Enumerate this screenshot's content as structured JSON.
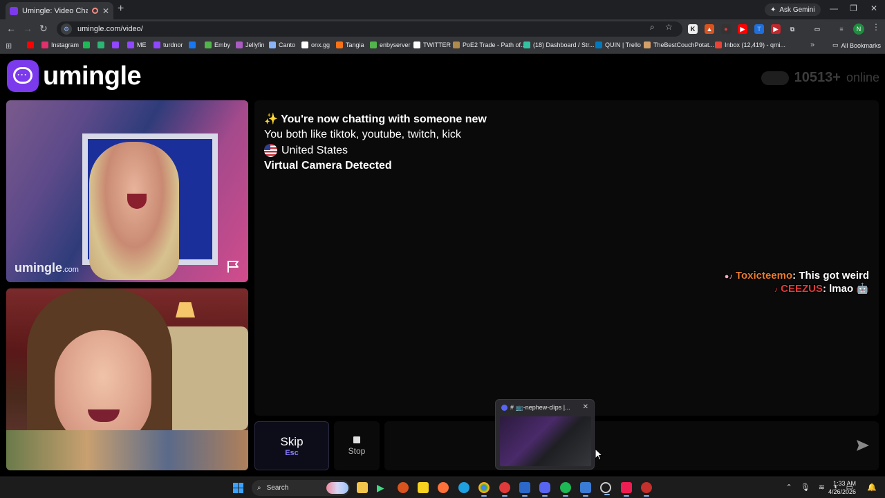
{
  "browser": {
    "tab_title": "Umingle: Video Chat with S",
    "new_tab_symbol": "+",
    "ask_gemini": "Ask Gemini",
    "url": "umingle.com/video/",
    "profile_initial": "N",
    "all_bookmarks": "All Bookmarks",
    "bookmarks": [
      {
        "label": "",
        "icon": "youtube-icon",
        "color": "#ff0000"
      },
      {
        "label": "Instagram",
        "icon": "instagram-icon",
        "color": "#e1306c"
      },
      {
        "label": "",
        "icon": "spotify-icon",
        "color": "#1db954"
      },
      {
        "label": "",
        "icon": "app-icon",
        "color": "#2bb673"
      },
      {
        "label": "",
        "icon": "twitch-icon",
        "color": "#9146ff"
      },
      {
        "label": "ME",
        "icon": "twitch-icon",
        "color": "#9146ff"
      },
      {
        "label": "turdnor",
        "icon": "twitch-icon",
        "color": "#9146ff"
      },
      {
        "label": "",
        "icon": "facebook-icon",
        "color": "#1877f2"
      },
      {
        "label": "Emby",
        "icon": "emby-icon",
        "color": "#52b54b"
      },
      {
        "label": "Jellyfin",
        "icon": "jellyfin-icon",
        "color": "#aa5cc3"
      },
      {
        "label": "Canto",
        "icon": "canto-icon",
        "color": "#8ab4f8"
      },
      {
        "label": "onx.gg",
        "icon": "onx-icon",
        "color": "#ffffff"
      },
      {
        "label": "Tangia",
        "icon": "tangia-icon",
        "color": "#f97316"
      },
      {
        "label": "enbyserver",
        "icon": "emby-icon",
        "color": "#52b54b"
      },
      {
        "label": "TWITTER",
        "icon": "x-icon",
        "color": "#ffffff"
      },
      {
        "label": "PoE2 Trade - Path of...",
        "icon": "poe-icon",
        "color": "#b08a4a"
      },
      {
        "label": "(18) Dashboard / Str...",
        "icon": "streamlabs-icon",
        "color": "#31c3a2"
      },
      {
        "label": "QUIN | Trello",
        "icon": "trello-icon",
        "color": "#0079bf"
      },
      {
        "label": "TheBestCouchPotat...",
        "icon": "couch-icon",
        "color": "#d4a06a"
      },
      {
        "label": "Inbox (12,419) - qmi...",
        "icon": "gmail-icon",
        "color": "#ea4335"
      }
    ]
  },
  "site": {
    "logo_text": "umingle",
    "online_count": "10513+",
    "online_label": "online",
    "watermark_main": "umingle",
    "watermark_suffix": ".com"
  },
  "chat": {
    "new_partner": "✨ You're now chatting with someone new",
    "shared_interests": "You both like tiktok, youtube, twitch, kick",
    "country": "United States",
    "virtual_camera": "Virtual Camera Detected",
    "overlay_messages": [
      {
        "icons": "●♪",
        "user": "Toxicteemo",
        "text": ": This got weird",
        "color": "#e87a2f"
      },
      {
        "icons": "♪",
        "user": "CEEZUS",
        "text": ": lmao 🤖",
        "color": "#e23a3a"
      }
    ]
  },
  "controls": {
    "skip_label": "Skip",
    "skip_key": "Esc",
    "stop_label": "Stop",
    "message_placeholder": ""
  },
  "thumbnail": {
    "title": "# 📺-nephew-clips |..."
  },
  "taskbar": {
    "search_label": "Search",
    "time": "1:33 AM",
    "date": "4/26/2026"
  },
  "colors": {
    "brand": "#7c3aed",
    "skip_accent": "#8b7fff"
  }
}
